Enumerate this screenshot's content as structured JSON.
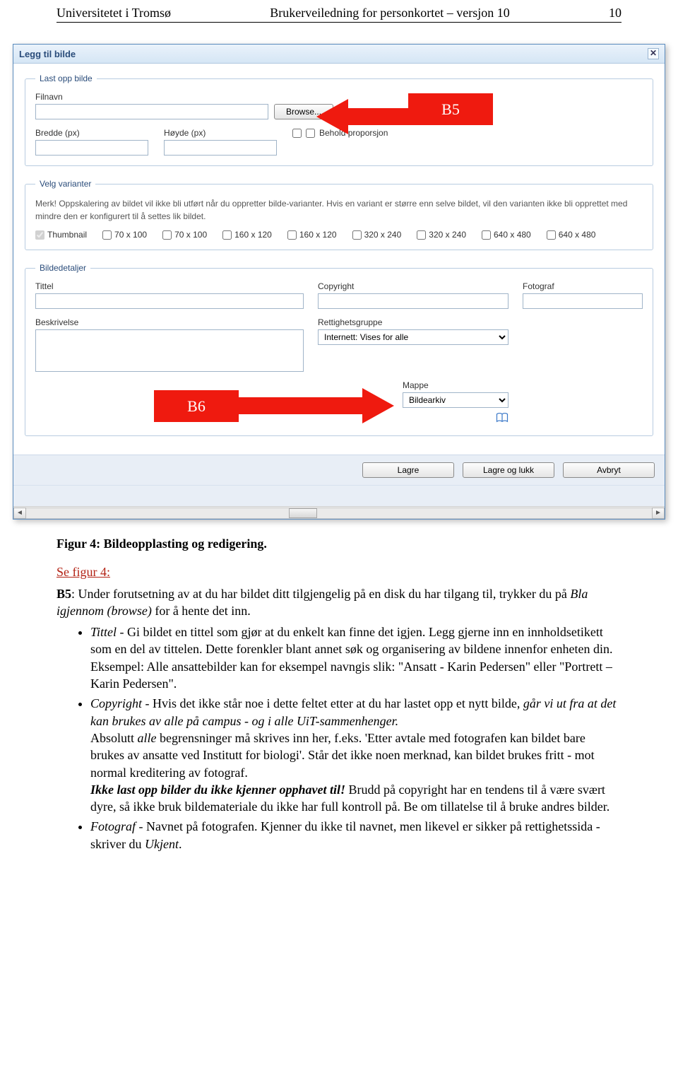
{
  "header": {
    "left": "Universitetet i Tromsø",
    "center": "Brukerveiledning for personkortet – versjon 10",
    "right": "10"
  },
  "callouts": {
    "b5": "B5",
    "b6": "B6"
  },
  "dialog": {
    "title": "Legg til bilde",
    "upload_legend": "Last opp bilde",
    "variants_legend": "Velg varianter",
    "details_legend": "Bildedetaljer",
    "labels": {
      "filnavn": "Filnavn",
      "browse": "Browse...",
      "bredde": "Bredde (px)",
      "hoyde": "Høyde (px)",
      "behold": "Behold proporsjon",
      "tittel": "Tittel",
      "copyright": "Copyright",
      "fotograf": "Fotograf",
      "beskrivelse": "Beskrivelse",
      "rettighetsgruppe": "Rettighetsgruppe",
      "mappe": "Mappe"
    },
    "merk": "Merk! Oppskalering av bildet vil ikke bli utført når du oppretter bilde-varianter. Hvis en variant er større enn selve bildet, vil den varianten ikke bli opprettet med mindre den er konfigurert til å settes lik bildet.",
    "variants": [
      "Thumbnail",
      "70 x 100",
      "70 x 100",
      "160 x 120",
      "160 x 120",
      "320 x 240",
      "320 x 240",
      "640 x 480",
      "640 x 480"
    ],
    "rettighets_value": "Internett: Vises for alle",
    "mappe_value": "Bildearkiv",
    "actions": {
      "lagre": "Lagre",
      "lagre_lukk": "Lagre og lukk",
      "avbryt": "Avbryt"
    }
  },
  "caption": "Figur 4: Bildeopplasting og redigering.",
  "text": {
    "intro1a": "Se figur 4:",
    "intro2a": "B5",
    "intro2b": ": Under forutsetning av at du har bildet ditt tilgjengelig på en disk du har tilgang til, trykker du på ",
    "intro2c": "Bla igjennom (browse)",
    "intro2d": " for å hente det inn.",
    "b_tittel_a": "Tittel",
    "b_tittel_b": " - Gi bildet en tittel som gjør at du enkelt kan finne det igjen. Legg gjerne inn en innholdsetikett som en del av tittelen. Dette forenkler blant annet søk og organisering av bildene innenfor enheten din. Eksempel: Alle ansattebilder kan for eksempel navngis slik: \"Ansatt - Karin Pedersen\" eller \"Portrett – Karin Pedersen\".",
    "b_copy_a": "Copyright",
    "b_copy_b": " - Hvis det ikke står noe i dette feltet etter at du har lastet opp et nytt bilde, ",
    "b_copy_c": "går vi ut fra at det kan brukes av alle på campus - og i alle UiT-sammenhenger.",
    "b_copy_d": "Absolutt ",
    "b_copy_e": "alle",
    "b_copy_f": " begrensninger må skrives inn her, f.eks. 'Etter avtale med fotografen kan bildet bare brukes av ansatte ved Institutt for biologi'. Står det ikke noen merknad, kan bildet brukes fritt - mot normal kreditering av fotograf.",
    "b_copy_g": "Ikke last opp bilder du ikke kjenner opphavet til!",
    "b_copy_h": " Brudd på copyright har en tendens til å være svært dyre, så ikke bruk bildemateriale du ikke har full kontroll på. Be om tillatelse til å bruke andres bilder.",
    "b_foto_a": "Fotograf",
    "b_foto_b": " - Navnet på fotografen. Kjenner du ikke til navnet, men likevel er sikker på rettighetssida - skriver du ",
    "b_foto_c": "Ukjent",
    "b_foto_d": "."
  }
}
